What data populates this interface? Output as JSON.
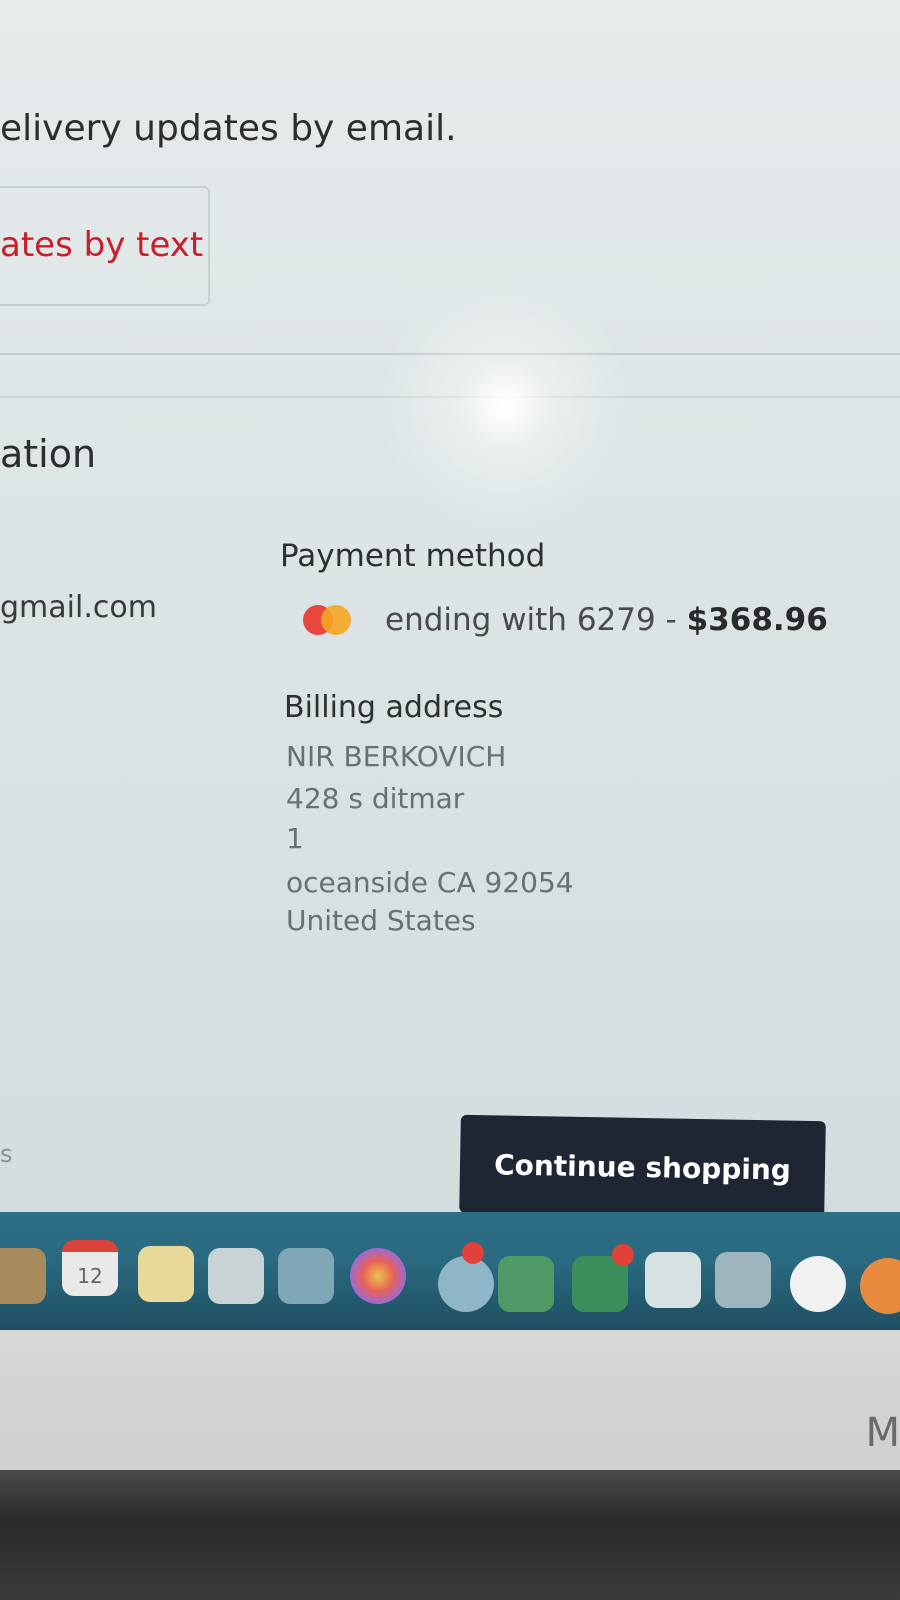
{
  "notifications": {
    "email_updates_text": "elivery updates by email.",
    "text_updates_link": "ates by text"
  },
  "order_info": {
    "section_heading": "ation",
    "contact_email": "gmail.com"
  },
  "payment": {
    "heading": "Payment method",
    "card_icon": "mastercard-icon",
    "card_ending": "ending with 6279 - ",
    "amount": "$368.96"
  },
  "billing": {
    "heading": "Billing address",
    "name": "NIR BERKOVICH",
    "line1": "428 s ditmar",
    "line2": "1",
    "city_line": "oceanside CA 92054",
    "country": "United States"
  },
  "footer": {
    "left_fragment": "s",
    "continue_label": "Continue shopping"
  },
  "dock": {
    "calendar_day": "12",
    "icons": [
      "finder-icon",
      "calendar-icon",
      "notes-icon",
      "reminders-icon",
      "maps-icon",
      "photos-icon",
      "messages-icon",
      "numbers-icon",
      "facetime-icon",
      "keynote-icon",
      "podium-icon",
      "music-icon"
    ]
  },
  "bezel": {
    "letter": "M"
  },
  "colors": {
    "link_red": "#c8202a",
    "button_dark": "#1f2633"
  }
}
